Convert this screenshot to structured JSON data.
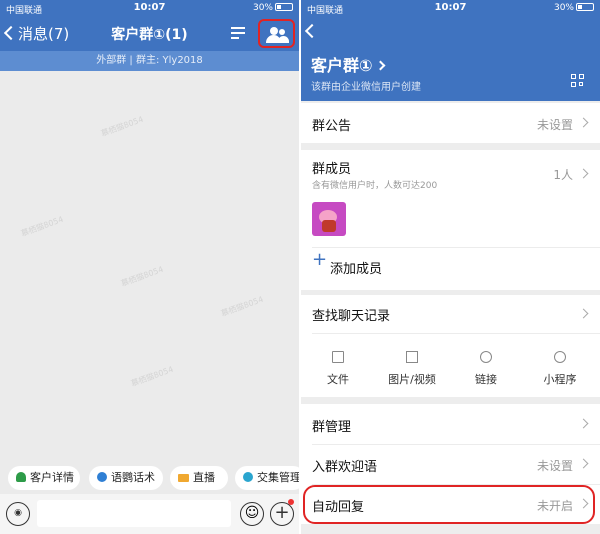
{
  "left": {
    "status": {
      "carrier": "中国联通",
      "time": "10:07",
      "battery": "30%"
    },
    "nav": {
      "back_label": "消息(7)",
      "title": "客户群①(1)"
    },
    "subbar": "外部群 | 群主: Yly2018",
    "watermark": "慕栖猫8054",
    "quick_actions": [
      "客户详情",
      "语鹦话术",
      "直播",
      "交集管理"
    ],
    "input": {
      "placeholder": ""
    },
    "icons": {
      "voice": "voice-input-icon",
      "emoji": "emoji-icon",
      "plus": "plus-icon",
      "members": "group-members-icon",
      "filter": "filter-icon"
    }
  },
  "right": {
    "status": {
      "carrier": "中国联通",
      "time": "10:07",
      "battery": "30%"
    },
    "group": {
      "name": "客户群①",
      "subtitle": "该群由企业微信用户创建"
    },
    "announcement": {
      "label": "群公告",
      "value": "未设置"
    },
    "members": {
      "label": "群成员",
      "count": "1人",
      "hint": "含有微信用户时，人数可达200",
      "add_label": "添加成员"
    },
    "history": {
      "label": "查找聊天记录",
      "tools": [
        "文件",
        "图片/视频",
        "链接",
        "小程序"
      ]
    },
    "settings": [
      {
        "label": "群管理",
        "value": ""
      },
      {
        "label": "入群欢迎语",
        "value": "未设置"
      },
      {
        "label": "自动回复",
        "value": "未开启"
      }
    ]
  },
  "colors": {
    "accent": "#3f73c0",
    "highlight": "#e02424",
    "background": "#ebebeb"
  }
}
